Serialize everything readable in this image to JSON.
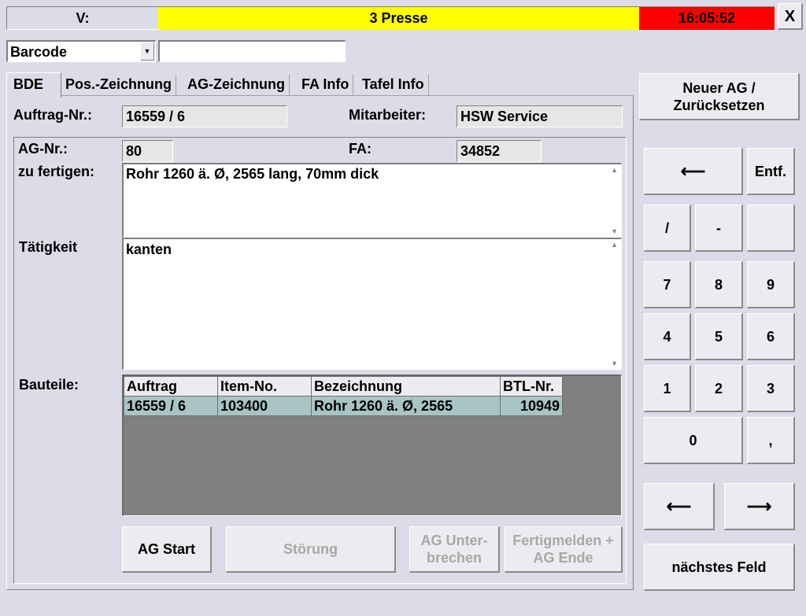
{
  "topbar": {
    "v_label": "V:",
    "machine": "3 Presse",
    "time": "16:05:52",
    "close_label": "X",
    "machine_color": "#ffff00",
    "time_color": "#ff0000"
  },
  "input": {
    "select_value": "Barcode",
    "text_value": ""
  },
  "tabs": [
    "BDE",
    "Pos.-Zeichnung",
    "AG-Zeichnung",
    "FA Info",
    "Tafel Info"
  ],
  "form": {
    "auftrag_label": "Auftrag-Nr.:",
    "auftrag_value": "16559 / 6",
    "mitarbeiter_label": "Mitarbeiter:",
    "mitarbeiter_value": "HSW Service",
    "ag_label": "AG-Nr.:",
    "ag_value": "80",
    "fa_label": "FA:",
    "fa_value": "34852",
    "zu_fertigen_label": "zu fertigen:",
    "zu_fertigen_value": "Rohr 1260 ä. Ø, 2565 lang, 70mm dick",
    "taetigkeit_label": "Tätigkeit",
    "taetigkeit_value": "kanten",
    "bauteile_label": "Bauteile:"
  },
  "table": {
    "headers": [
      "Auftrag",
      "Item-No.",
      "Bezeichnung",
      "BTL-Nr."
    ],
    "rows": [
      [
        "16559 / 6",
        "103400",
        "Rohr 1260 ä. Ø, 2565",
        "10949"
      ]
    ]
  },
  "actions": {
    "ag_start": "AG Start",
    "stoerung": "Störung",
    "ag_unterbrechen_1": "AG Unter-",
    "ag_unterbrechen_2": "brechen",
    "fertig_1": "Fertigmelden +",
    "fertig_2": "AG Ende"
  },
  "right": {
    "neuer_ag_1": "Neuer AG /",
    "neuer_ag_2": "Zurücksetzen",
    "backspace": "⟵",
    "entf": "Entf.",
    "keys": [
      "/",
      "-",
      "",
      "7",
      "8",
      "9",
      "4",
      "5",
      "6",
      "1",
      "2",
      "3"
    ],
    "zero": "0",
    "comma": ",",
    "left_arrow": "⟵",
    "right_arrow": "⟶",
    "next_field": "nächstes Feld"
  }
}
